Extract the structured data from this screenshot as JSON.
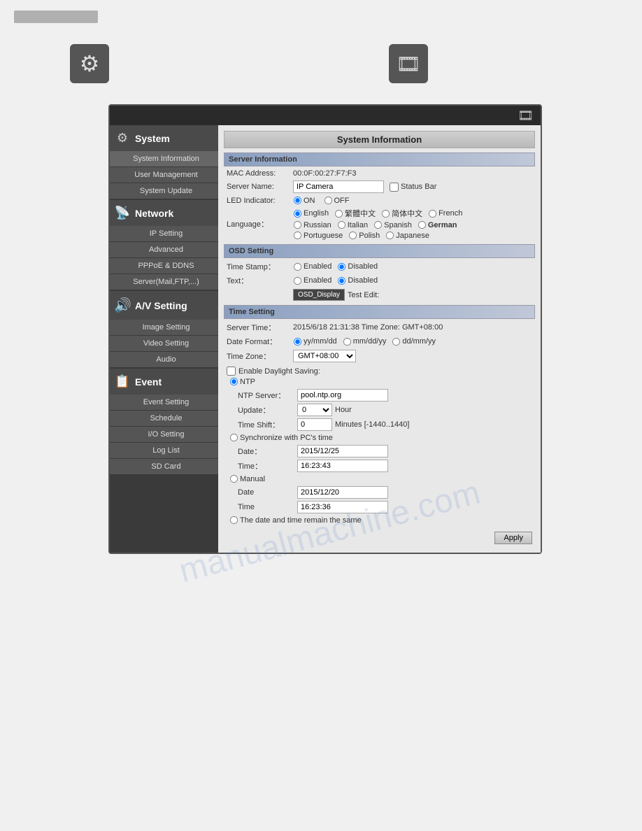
{
  "topbar": {
    "gray_bar_label": ""
  },
  "icons": {
    "gear": "⚙",
    "film": "🎞"
  },
  "ui": {
    "top_icon": "🎞",
    "panel_title": "System Information"
  },
  "sidebar": {
    "system_label": "System",
    "system_icon": "⚙",
    "system_items": [
      {
        "label": "System Information"
      },
      {
        "label": "User Management"
      },
      {
        "label": "System Update"
      }
    ],
    "network_label": "Network",
    "network_icon": "📡",
    "network_items": [
      {
        "label": "IP Setting"
      },
      {
        "label": "Advanced"
      },
      {
        "label": "PPPoE & DDNS"
      },
      {
        "label": "Server(Mail,FTP,...)"
      }
    ],
    "av_label": "A/V Setting",
    "av_icon": "🔊",
    "av_items": [
      {
        "label": "Image Setting"
      },
      {
        "label": "Video Setting"
      },
      {
        "label": "Audio"
      }
    ],
    "event_label": "Event",
    "event_icon": "📋",
    "event_items": [
      {
        "label": "Event Setting"
      },
      {
        "label": "Schedule"
      },
      {
        "label": "I/O Setting"
      },
      {
        "label": "Log List"
      },
      {
        "label": "SD Card"
      }
    ]
  },
  "server_info": {
    "section_label": "Server Information",
    "mac_label": "MAC Address:",
    "mac_value": "00:0F:00:27:F7:F3",
    "server_name_label": "Server Name:",
    "server_name_value": "IP Camera",
    "status_bar_label": "Status Bar",
    "led_label": "LED Indicator:",
    "led_on": "ON",
    "led_off": "OFF",
    "language_label": "Language：",
    "lang_options": [
      "English",
      "繁體中文",
      "简体中文",
      "French",
      "Russian",
      "Italian",
      "Spanish",
      "German",
      "Portuguese",
      "Polish",
      "Japanese"
    ]
  },
  "osd": {
    "section_label": "OSD Setting",
    "timestamp_label": "Time Stamp：",
    "enabled_label": "Enabled",
    "disabled_label": "Disabled",
    "text_label": "Text：",
    "text_enabled": "Enabled",
    "text_disabled": "Disabled",
    "osd_display": "OSD_Display",
    "test_edit": "Test Edit:"
  },
  "time_setting": {
    "section_label": "Time Setting",
    "server_time_label": "Server Time：",
    "server_time_value": "2015/6/18 21:31:38 Time Zone: GMT+08:00",
    "date_format_label": "Date Format：",
    "yy_mm_dd": "yy/mm/dd",
    "mm_dd_yy": "mm/dd/yy",
    "dd_mm_yy": "dd/mm/yy",
    "timezone_label": "Time Zone：",
    "timezone_value": "GMT+08:00",
    "daylight_label": "Enable Daylight Saving:",
    "ntp_label": "NTP",
    "ntp_server_label": "NTP Server：",
    "ntp_server_value": "pool.ntp.org",
    "update_label": "Update：",
    "update_value": "0",
    "hour_label": "Hour",
    "time_shift_label": "Time Shift：",
    "time_shift_value": "0",
    "minutes_hint": "Minutes [-1440..1440]",
    "sync_pc_label": "Synchronize with PC's time",
    "sync_date_label": "Date：",
    "sync_date_value": "2015/12/25",
    "sync_time_label": "Time：",
    "sync_time_value": "16:23:43",
    "manual_label": "Manual",
    "manual_date_label": "Date",
    "manual_date_value": "2015/12/20",
    "manual_time_label": "Time",
    "manual_time_value": "16:23:36",
    "same_label": "The date and time remain the same",
    "apply_label": "Apply"
  },
  "watermark": "manualmachine.com"
}
